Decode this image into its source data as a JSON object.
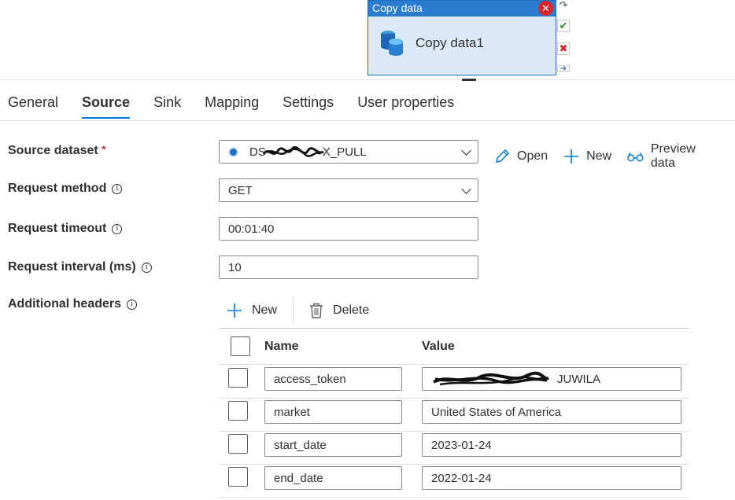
{
  "activity": {
    "type_label": "Copy data",
    "name": "Copy data1",
    "close_glyph": "✕"
  },
  "tabs": [
    {
      "label": "General"
    },
    {
      "label": "Source"
    },
    {
      "label": "Sink"
    },
    {
      "label": "Mapping"
    },
    {
      "label": "Settings"
    },
    {
      "label": "User properties"
    }
  ],
  "form": {
    "source_dataset": {
      "label": "Source dataset",
      "required_mark": "*",
      "value_prefix": "DS",
      "value_suffix": "X_PULL"
    },
    "request_method": {
      "label": "Request method",
      "value": "GET"
    },
    "request_timeout": {
      "label": "Request timeout",
      "value": "00:01:40"
    },
    "request_interval": {
      "label": "Request interval (ms)",
      "value": "10"
    },
    "additional_headers": {
      "label": "Additional headers"
    },
    "info_glyph": "i"
  },
  "dataset_actions": {
    "open": "Open",
    "new": "New",
    "preview": "Preview data"
  },
  "headers": {
    "toolbar": {
      "new": "New",
      "delete": "Delete"
    },
    "columns": {
      "name": "Name",
      "value": "Value"
    },
    "rows": [
      {
        "name": "access_token",
        "value": "JUWILA"
      },
      {
        "name": "market",
        "value": "United States of America"
      },
      {
        "name": "start_date",
        "value": "2023-01-24"
      },
      {
        "name": "end_date",
        "value": "2022-01-24"
      }
    ]
  },
  "colors": {
    "accent": "#0078d4",
    "activity_header": "#2b7bd0",
    "activity_body": "#dceaf8",
    "required": "#a4262c"
  }
}
